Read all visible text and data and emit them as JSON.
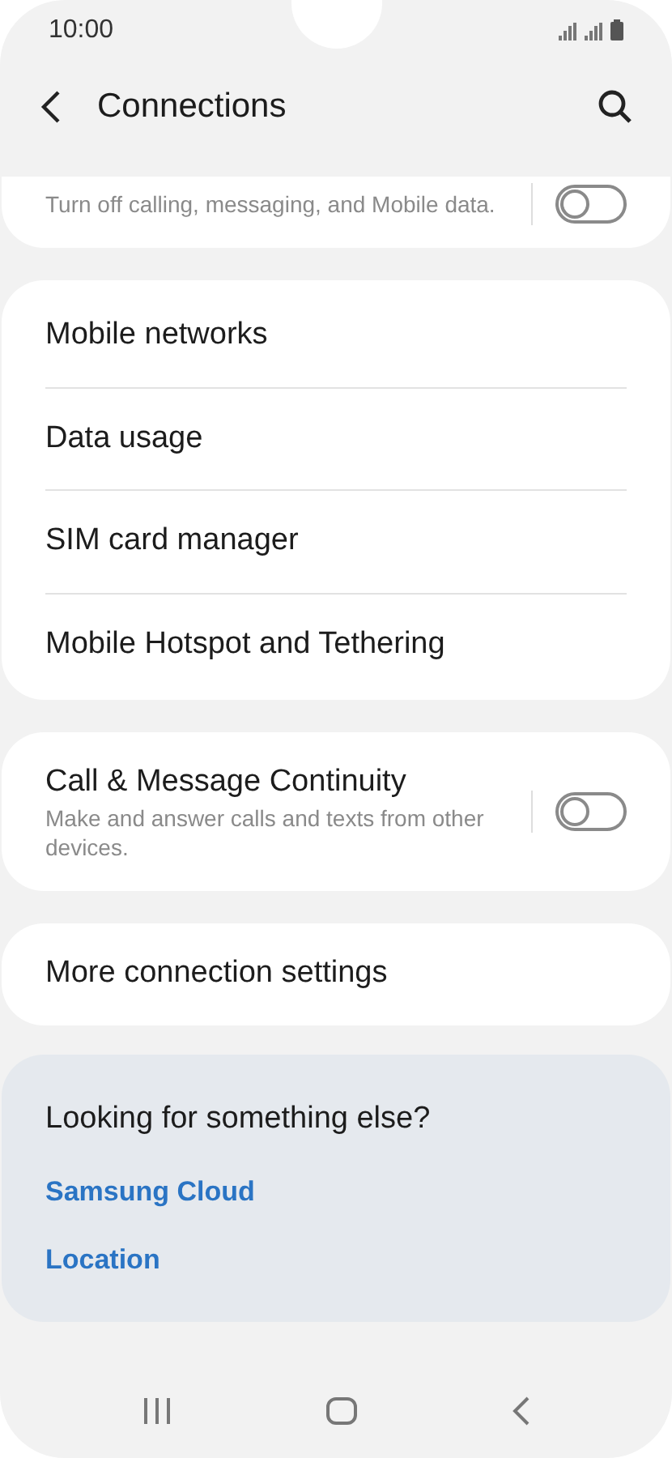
{
  "status_bar": {
    "time": "10:00"
  },
  "header": {
    "title": "Connections"
  },
  "groups": [
    {
      "items": [
        {
          "kind": "toggle",
          "subtitle": "Turn off calling, messaging, and Mobile data.",
          "on": false
        }
      ]
    },
    {
      "items": [
        {
          "kind": "link",
          "title": "Mobile networks"
        },
        {
          "kind": "link",
          "title": "Data usage"
        },
        {
          "kind": "link",
          "title": "SIM card manager"
        },
        {
          "kind": "link",
          "title": "Mobile Hotspot and Tethering"
        }
      ]
    },
    {
      "items": [
        {
          "kind": "toggle",
          "title": "Call & Message Continuity",
          "subtitle": "Make and answer calls and texts from other devices.",
          "on": false
        }
      ]
    },
    {
      "items": [
        {
          "kind": "link",
          "title": "More connection settings"
        }
      ]
    }
  ],
  "suggestions": {
    "title": "Looking for something else?",
    "links": [
      "Samsung Cloud",
      "Location"
    ]
  }
}
